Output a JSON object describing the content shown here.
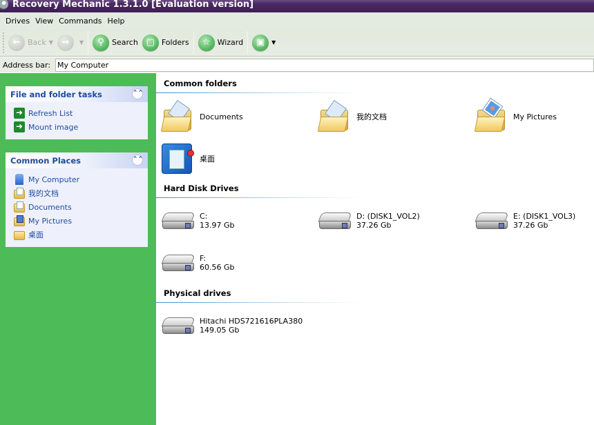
{
  "window": {
    "title": "Recovery Mechanic 1.3.1.0 [Evaluation version]"
  },
  "menu": [
    "Drives",
    "View",
    "Commands",
    "Help"
  ],
  "toolbar": {
    "back": {
      "label": "Back",
      "icon": "back-arrow-icon",
      "enabled": false
    },
    "forward": {
      "label": "",
      "icon": "forward-arrow-icon",
      "enabled": false
    },
    "search": {
      "label": "Search",
      "icon": "search-icon"
    },
    "folders": {
      "label": "Folders",
      "icon": "folder-icon"
    },
    "wizard": {
      "label": "Wizard",
      "icon": "star-icon"
    },
    "save": {
      "label": "",
      "icon": "floppy-disk-icon"
    }
  },
  "address_bar": {
    "label": "Address bar:",
    "value": "My Computer"
  },
  "sidebar": {
    "file_tasks": {
      "title": "File and folder tasks",
      "items": [
        {
          "label": "Refresh List",
          "icon": "green-arrow-icon"
        },
        {
          "label": "Mount image",
          "icon": "green-arrow-icon"
        }
      ]
    },
    "common_places": {
      "title": "Common Places",
      "items": [
        {
          "label": "My Computer",
          "icon": "computer-icon"
        },
        {
          "label": "我的文档",
          "icon": "documents-folder-icon"
        },
        {
          "label": "Documents",
          "icon": "documents-folder-icon"
        },
        {
          "label": "My Pictures",
          "icon": "pictures-folder-icon"
        },
        {
          "label": "桌面",
          "icon": "folder-icon"
        }
      ]
    }
  },
  "content": {
    "common_folders": {
      "title": "Common folders",
      "items": [
        {
          "name": "Documents",
          "icon": "documents-folder-icon"
        },
        {
          "name": "我的文档",
          "icon": "documents-folder-icon"
        },
        {
          "name": "My Pictures",
          "icon": "pictures-folder-icon"
        },
        {
          "name": "桌面",
          "icon": "desktop-icon"
        }
      ]
    },
    "hard_disk_drives": {
      "title": "Hard Disk Drives",
      "items": [
        {
          "name": "C:",
          "size": "13.97 Gb"
        },
        {
          "name": "D: (DISK1_VOL2)",
          "size": "37.26 Gb"
        },
        {
          "name": "E: (DISK1_VOL3)",
          "size": "37.26 Gb"
        },
        {
          "name": "F:",
          "size": "60.56 Gb"
        }
      ]
    },
    "physical_drives": {
      "title": "Physical drives",
      "items": [
        {
          "name": "Hitachi HDS721616PLA380",
          "size": "149.05 Gb"
        }
      ]
    }
  },
  "colors": {
    "sidebar_bg": "#4cbb58",
    "titlebar": "#4a2a62",
    "panel_title": "#1f4b9c"
  }
}
